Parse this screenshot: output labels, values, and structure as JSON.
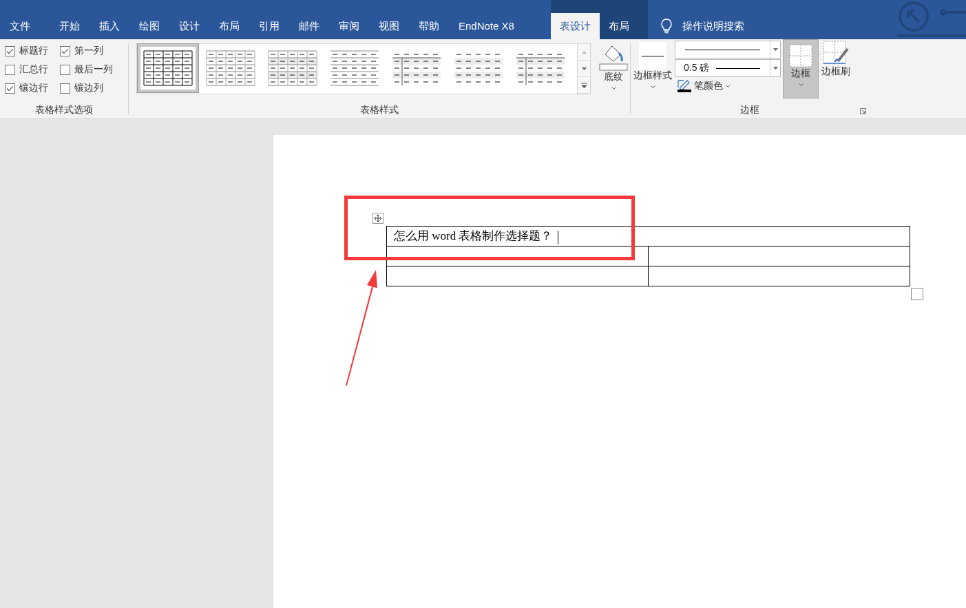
{
  "tabs": [
    {
      "label": "文件",
      "selected": false
    },
    {
      "label": "开始",
      "selected": false
    },
    {
      "label": "插入",
      "selected": false
    },
    {
      "label": "绘图",
      "selected": false
    },
    {
      "label": "设计",
      "selected": false
    },
    {
      "label": "布局",
      "selected": false
    },
    {
      "label": "引用",
      "selected": false
    },
    {
      "label": "邮件",
      "selected": false
    },
    {
      "label": "审阅",
      "selected": false
    },
    {
      "label": "视图",
      "selected": false
    },
    {
      "label": "帮助",
      "selected": false
    },
    {
      "label": "EndNote X8",
      "selected": false
    }
  ],
  "context_tabs": [
    {
      "label": "表设计",
      "selected": true
    },
    {
      "label": "布局",
      "selected": false
    }
  ],
  "search": {
    "placeholder": "操作说明搜索"
  },
  "style_options": {
    "label": "表格样式选项",
    "options": [
      {
        "label": "标题行",
        "checked": true
      },
      {
        "label": "第一列",
        "checked": true
      },
      {
        "label": "汇总行",
        "checked": false
      },
      {
        "label": "最后一列",
        "checked": false
      },
      {
        "label": "镶边行",
        "checked": true
      },
      {
        "label": "镶边列",
        "checked": false
      }
    ]
  },
  "table_styles": {
    "label": "表格样式",
    "gallery": [
      {
        "kind": "grid",
        "selected": true
      },
      {
        "kind": "light-grid",
        "selected": false
      },
      {
        "kind": "banded-grid",
        "selected": false
      },
      {
        "kind": "lines",
        "selected": false
      },
      {
        "kind": "first-column",
        "selected": false
      },
      {
        "kind": "banded",
        "selected": false
      },
      {
        "kind": "first-column-lines",
        "selected": false
      }
    ],
    "shading": "底纹"
  },
  "borders": {
    "label": "边框",
    "border_styles": "边框样式",
    "pen_weight": "0.5 磅",
    "pen_color": "笔颜色",
    "border_button": {
      "label": "边框",
      "selected": true
    },
    "border_painter": "边框刷"
  },
  "document_table": {
    "rows": [
      [
        "怎么用 word 表格制作选择题？"
      ],
      [
        "",
        ""
      ],
      [
        "",
        ""
      ]
    ]
  }
}
